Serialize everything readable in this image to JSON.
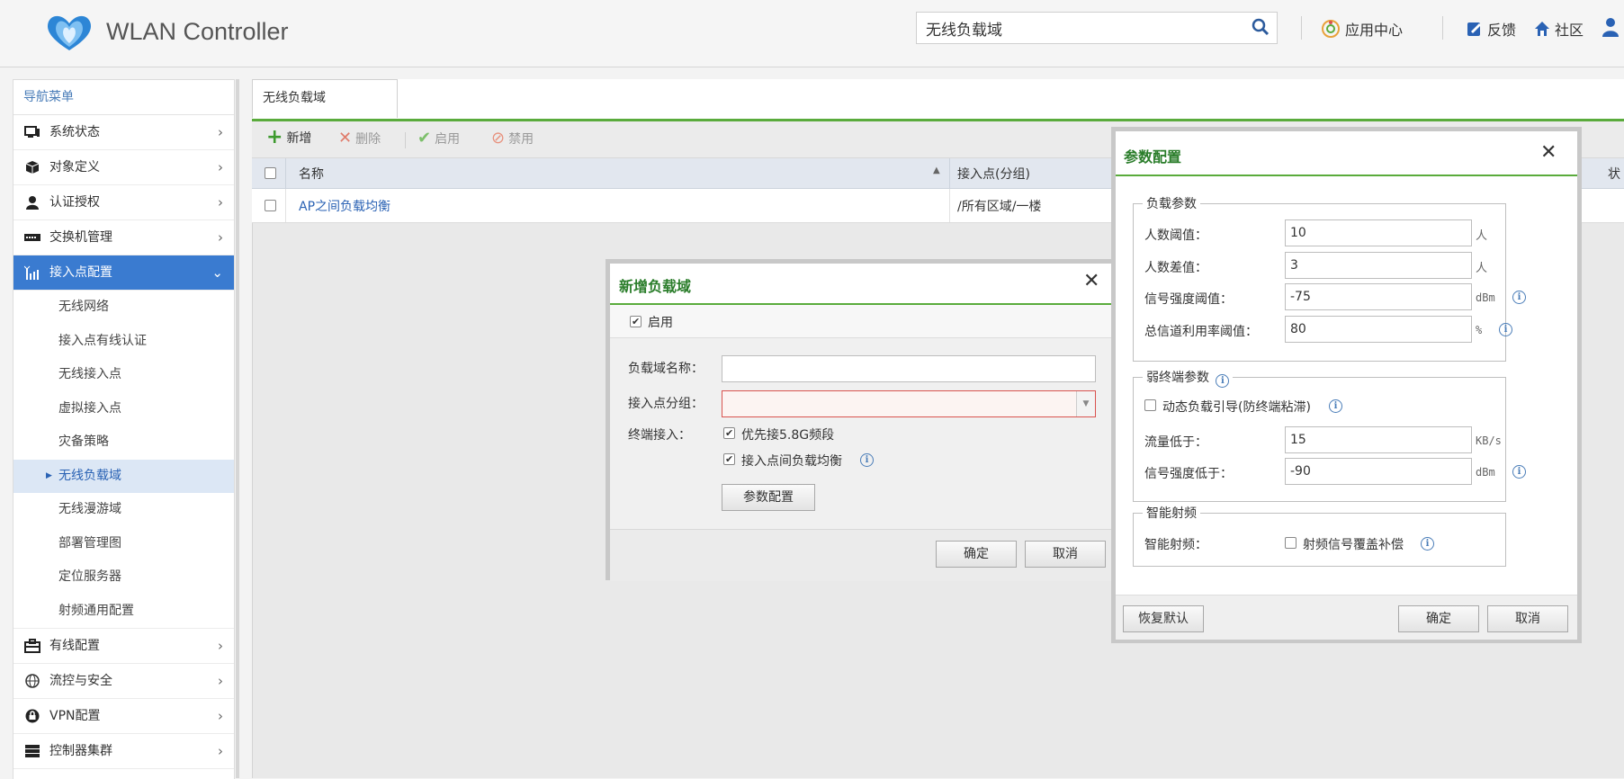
{
  "header": {
    "app_title": "WLAN Controller",
    "search_value": "无线负载域",
    "links": [
      "应用中心",
      "反馈",
      "社区"
    ]
  },
  "sidebar": {
    "title": "导航菜单",
    "items": [
      {
        "label": "系统状态"
      },
      {
        "label": "对象定义"
      },
      {
        "label": "认证授权"
      },
      {
        "label": "交换机管理"
      },
      {
        "label": "接入点配置"
      }
    ],
    "sub_items": [
      "无线网络",
      "接入点有线认证",
      "无线接入点",
      "虚拟接入点",
      "灾备策略",
      "无线负载域",
      "无线漫游域",
      "部署管理图",
      "定位服务器",
      "射频通用配置"
    ],
    "items_after": [
      {
        "label": "有线配置"
      },
      {
        "label": "流控与安全"
      },
      {
        "label": "VPN配置"
      },
      {
        "label": "控制器集群"
      }
    ]
  },
  "tab": {
    "label": "无线负载域"
  },
  "toolbar": {
    "add": "新增",
    "delete": "删除",
    "enable": "启用",
    "disable": "禁用"
  },
  "grid": {
    "columns": [
      "名称",
      "接入点(分组)",
      "状"
    ],
    "rows": [
      {
        "name": "AP之间负载均衡",
        "ap_group": "/所有区域/一楼"
      }
    ]
  },
  "dialog_add": {
    "title": "新增负载域",
    "enable_label": "启用",
    "name_label": "负载域名称：",
    "name_value": "",
    "group_label": "接入点分组：",
    "group_value": "",
    "terminal_label": "终端接入：",
    "opt1": "优先接5.8G频段",
    "opt2": "接入点间负载均衡",
    "param_button": "参数配置",
    "ok": "确定",
    "cancel": "取消"
  },
  "dialog_param": {
    "title": "参数配置",
    "load_legend": "负载参数",
    "user_threshold_label": "人数阈值：",
    "user_threshold_value": "10",
    "user_threshold_unit": "人",
    "user_diff_label": "人数差值：",
    "user_diff_value": "3",
    "user_diff_unit": "人",
    "signal_threshold_label": "信号强度阈值：",
    "signal_threshold_value": "-75",
    "signal_threshold_unit": "dBm",
    "channel_util_label": "总信道利用率阈值：",
    "channel_util_value": "80",
    "channel_util_unit": "%",
    "weak_legend": "弱终端参数",
    "dynamic_steer_label": "动态负载引导(防终端粘滞)",
    "traffic_label": "流量低于：",
    "traffic_value": "15",
    "traffic_unit": "KB/s",
    "weak_signal_label": "信号强度低于：",
    "weak_signal_value": "-90",
    "weak_signal_unit": "dBm",
    "smart_legend": "智能射频",
    "smart_label": "智能射频：",
    "smart_opt": "射频信号覆盖补偿",
    "restore": "恢复默认",
    "ok": "确定",
    "cancel": "取消"
  },
  "colors": {
    "accent_blue": "#3a7bd0",
    "accent_green": "#5aab3c",
    "title_green": "#2a7d2a"
  }
}
